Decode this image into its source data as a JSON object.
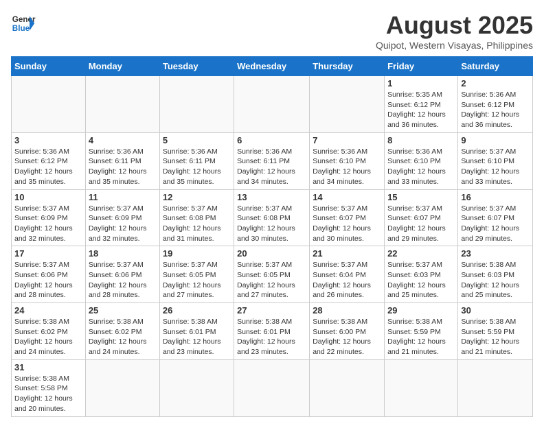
{
  "header": {
    "logo_general": "General",
    "logo_blue": "Blue",
    "title": "August 2025",
    "subtitle": "Quipot, Western Visayas, Philippines"
  },
  "days_of_week": [
    "Sunday",
    "Monday",
    "Tuesday",
    "Wednesday",
    "Thursday",
    "Friday",
    "Saturday"
  ],
  "weeks": [
    [
      {
        "day": "",
        "info": ""
      },
      {
        "day": "",
        "info": ""
      },
      {
        "day": "",
        "info": ""
      },
      {
        "day": "",
        "info": ""
      },
      {
        "day": "",
        "info": ""
      },
      {
        "day": "1",
        "info": "Sunrise: 5:35 AM\nSunset: 6:12 PM\nDaylight: 12 hours and 36 minutes."
      },
      {
        "day": "2",
        "info": "Sunrise: 5:36 AM\nSunset: 6:12 PM\nDaylight: 12 hours and 36 minutes."
      }
    ],
    [
      {
        "day": "3",
        "info": "Sunrise: 5:36 AM\nSunset: 6:12 PM\nDaylight: 12 hours and 35 minutes."
      },
      {
        "day": "4",
        "info": "Sunrise: 5:36 AM\nSunset: 6:11 PM\nDaylight: 12 hours and 35 minutes."
      },
      {
        "day": "5",
        "info": "Sunrise: 5:36 AM\nSunset: 6:11 PM\nDaylight: 12 hours and 35 minutes."
      },
      {
        "day": "6",
        "info": "Sunrise: 5:36 AM\nSunset: 6:11 PM\nDaylight: 12 hours and 34 minutes."
      },
      {
        "day": "7",
        "info": "Sunrise: 5:36 AM\nSunset: 6:10 PM\nDaylight: 12 hours and 34 minutes."
      },
      {
        "day": "8",
        "info": "Sunrise: 5:36 AM\nSunset: 6:10 PM\nDaylight: 12 hours and 33 minutes."
      },
      {
        "day": "9",
        "info": "Sunrise: 5:37 AM\nSunset: 6:10 PM\nDaylight: 12 hours and 33 minutes."
      }
    ],
    [
      {
        "day": "10",
        "info": "Sunrise: 5:37 AM\nSunset: 6:09 PM\nDaylight: 12 hours and 32 minutes."
      },
      {
        "day": "11",
        "info": "Sunrise: 5:37 AM\nSunset: 6:09 PM\nDaylight: 12 hours and 32 minutes."
      },
      {
        "day": "12",
        "info": "Sunrise: 5:37 AM\nSunset: 6:08 PM\nDaylight: 12 hours and 31 minutes."
      },
      {
        "day": "13",
        "info": "Sunrise: 5:37 AM\nSunset: 6:08 PM\nDaylight: 12 hours and 30 minutes."
      },
      {
        "day": "14",
        "info": "Sunrise: 5:37 AM\nSunset: 6:07 PM\nDaylight: 12 hours and 30 minutes."
      },
      {
        "day": "15",
        "info": "Sunrise: 5:37 AM\nSunset: 6:07 PM\nDaylight: 12 hours and 29 minutes."
      },
      {
        "day": "16",
        "info": "Sunrise: 5:37 AM\nSunset: 6:07 PM\nDaylight: 12 hours and 29 minutes."
      }
    ],
    [
      {
        "day": "17",
        "info": "Sunrise: 5:37 AM\nSunset: 6:06 PM\nDaylight: 12 hours and 28 minutes."
      },
      {
        "day": "18",
        "info": "Sunrise: 5:37 AM\nSunset: 6:06 PM\nDaylight: 12 hours and 28 minutes."
      },
      {
        "day": "19",
        "info": "Sunrise: 5:37 AM\nSunset: 6:05 PM\nDaylight: 12 hours and 27 minutes."
      },
      {
        "day": "20",
        "info": "Sunrise: 5:37 AM\nSunset: 6:05 PM\nDaylight: 12 hours and 27 minutes."
      },
      {
        "day": "21",
        "info": "Sunrise: 5:37 AM\nSunset: 6:04 PM\nDaylight: 12 hours and 26 minutes."
      },
      {
        "day": "22",
        "info": "Sunrise: 5:37 AM\nSunset: 6:03 PM\nDaylight: 12 hours and 25 minutes."
      },
      {
        "day": "23",
        "info": "Sunrise: 5:38 AM\nSunset: 6:03 PM\nDaylight: 12 hours and 25 minutes."
      }
    ],
    [
      {
        "day": "24",
        "info": "Sunrise: 5:38 AM\nSunset: 6:02 PM\nDaylight: 12 hours and 24 minutes."
      },
      {
        "day": "25",
        "info": "Sunrise: 5:38 AM\nSunset: 6:02 PM\nDaylight: 12 hours and 24 minutes."
      },
      {
        "day": "26",
        "info": "Sunrise: 5:38 AM\nSunset: 6:01 PM\nDaylight: 12 hours and 23 minutes."
      },
      {
        "day": "27",
        "info": "Sunrise: 5:38 AM\nSunset: 6:01 PM\nDaylight: 12 hours and 23 minutes."
      },
      {
        "day": "28",
        "info": "Sunrise: 5:38 AM\nSunset: 6:00 PM\nDaylight: 12 hours and 22 minutes."
      },
      {
        "day": "29",
        "info": "Sunrise: 5:38 AM\nSunset: 5:59 PM\nDaylight: 12 hours and 21 minutes."
      },
      {
        "day": "30",
        "info": "Sunrise: 5:38 AM\nSunset: 5:59 PM\nDaylight: 12 hours and 21 minutes."
      }
    ],
    [
      {
        "day": "31",
        "info": "Sunrise: 5:38 AM\nSunset: 5:58 PM\nDaylight: 12 hours and 20 minutes."
      },
      {
        "day": "",
        "info": ""
      },
      {
        "day": "",
        "info": ""
      },
      {
        "day": "",
        "info": ""
      },
      {
        "day": "",
        "info": ""
      },
      {
        "day": "",
        "info": ""
      },
      {
        "day": "",
        "info": ""
      }
    ]
  ]
}
